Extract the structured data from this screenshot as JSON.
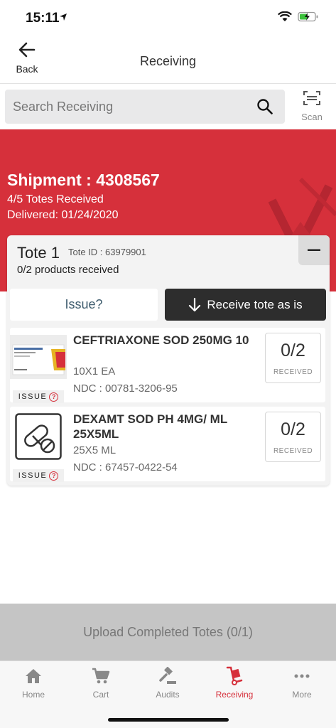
{
  "status_bar": {
    "time": "15:11"
  },
  "nav": {
    "back_label": "Back",
    "title": "Receiving"
  },
  "search": {
    "placeholder": "Search Receiving",
    "scan_label": "Scan"
  },
  "shipment": {
    "label": "Shipment :",
    "number": "4308567",
    "totes_received": "4/5 Totes Received",
    "delivered": "Delivered: 01/24/2020"
  },
  "tote": {
    "title": "Tote 1",
    "tote_id": "Tote ID : 63979901",
    "progress": "0/2 products received",
    "issue_label": "Issue?",
    "receive_label": "Receive tote as is"
  },
  "products": [
    {
      "name": "CEFTRIAXONE SOD 250MG 10",
      "pack": "10X1 EA",
      "ndc": "NDC : 00781-3206-95",
      "count": "0/2",
      "count_label": "RECEIVED",
      "issue_tag": "ISSUE",
      "image_icon": "ceftriaxone-box-image"
    },
    {
      "name": "DEXAMT SOD PH 4MG/ ML 25X5ML",
      "pack": "25X5 ML",
      "ndc": "NDC : 67457-0422-54",
      "count": "0/2",
      "count_label": "RECEIVED",
      "issue_tag": "ISSUE",
      "image_icon": "pill-placeholder-icon"
    }
  ],
  "upload": {
    "label": "Upload Completed Totes (0/1)"
  },
  "tabs": [
    {
      "label": "Home",
      "icon": "home-icon"
    },
    {
      "label": "Cart",
      "icon": "cart-icon"
    },
    {
      "label": "Audits",
      "icon": "gavel-icon"
    },
    {
      "label": "Receiving",
      "icon": "hand-truck-icon",
      "active": true
    },
    {
      "label": "More",
      "icon": "more-dots-icon"
    }
  ],
  "colors": {
    "accent": "#d6303b",
    "dark_button": "#2d2d2d",
    "upload_bg": "#c5c5c5"
  }
}
